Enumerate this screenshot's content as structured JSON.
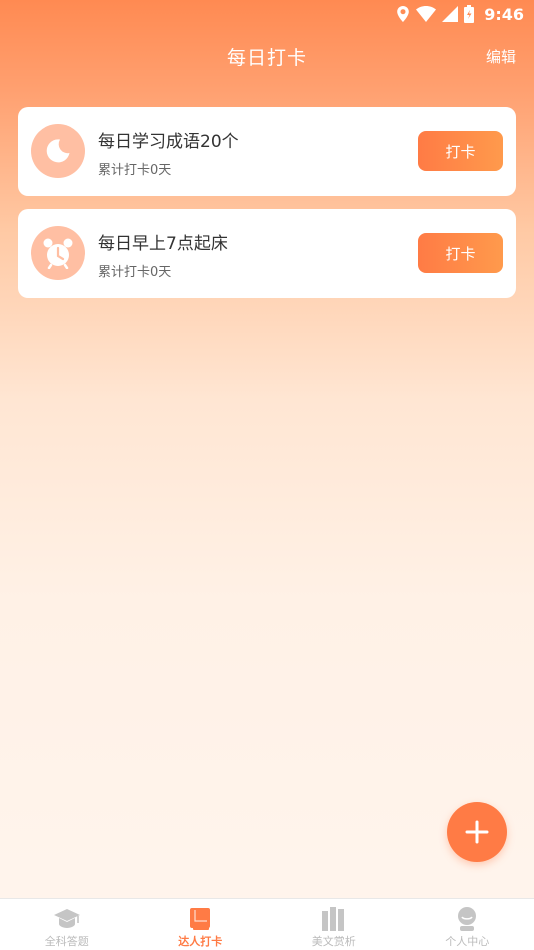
{
  "status_bar": {
    "time": "9:46"
  },
  "header": {
    "title": "每日打卡",
    "edit_label": "编辑"
  },
  "tasks": [
    {
      "title": "每日学习成语20个",
      "count": "累计打卡0天",
      "button": "打卡",
      "icon": "moon-icon"
    },
    {
      "title": "每日早上7点起床",
      "count": "累计打卡0天",
      "button": "打卡",
      "icon": "alarm-clock-icon"
    }
  ],
  "fab": {
    "icon": "plus-icon"
  },
  "bottom_nav": [
    {
      "label": "全科答题",
      "icon": "graduation-cap-icon",
      "active": false
    },
    {
      "label": "达人打卡",
      "icon": "book-icon",
      "active": true
    },
    {
      "label": "美文赏析",
      "icon": "books-icon",
      "active": false
    },
    {
      "label": "个人中心",
      "icon": "person-icon",
      "active": false
    }
  ],
  "colors": {
    "accent": "#ff7b45",
    "icon_bg": "#ffbfa3",
    "nav_inactive": "#bbbbbb"
  }
}
